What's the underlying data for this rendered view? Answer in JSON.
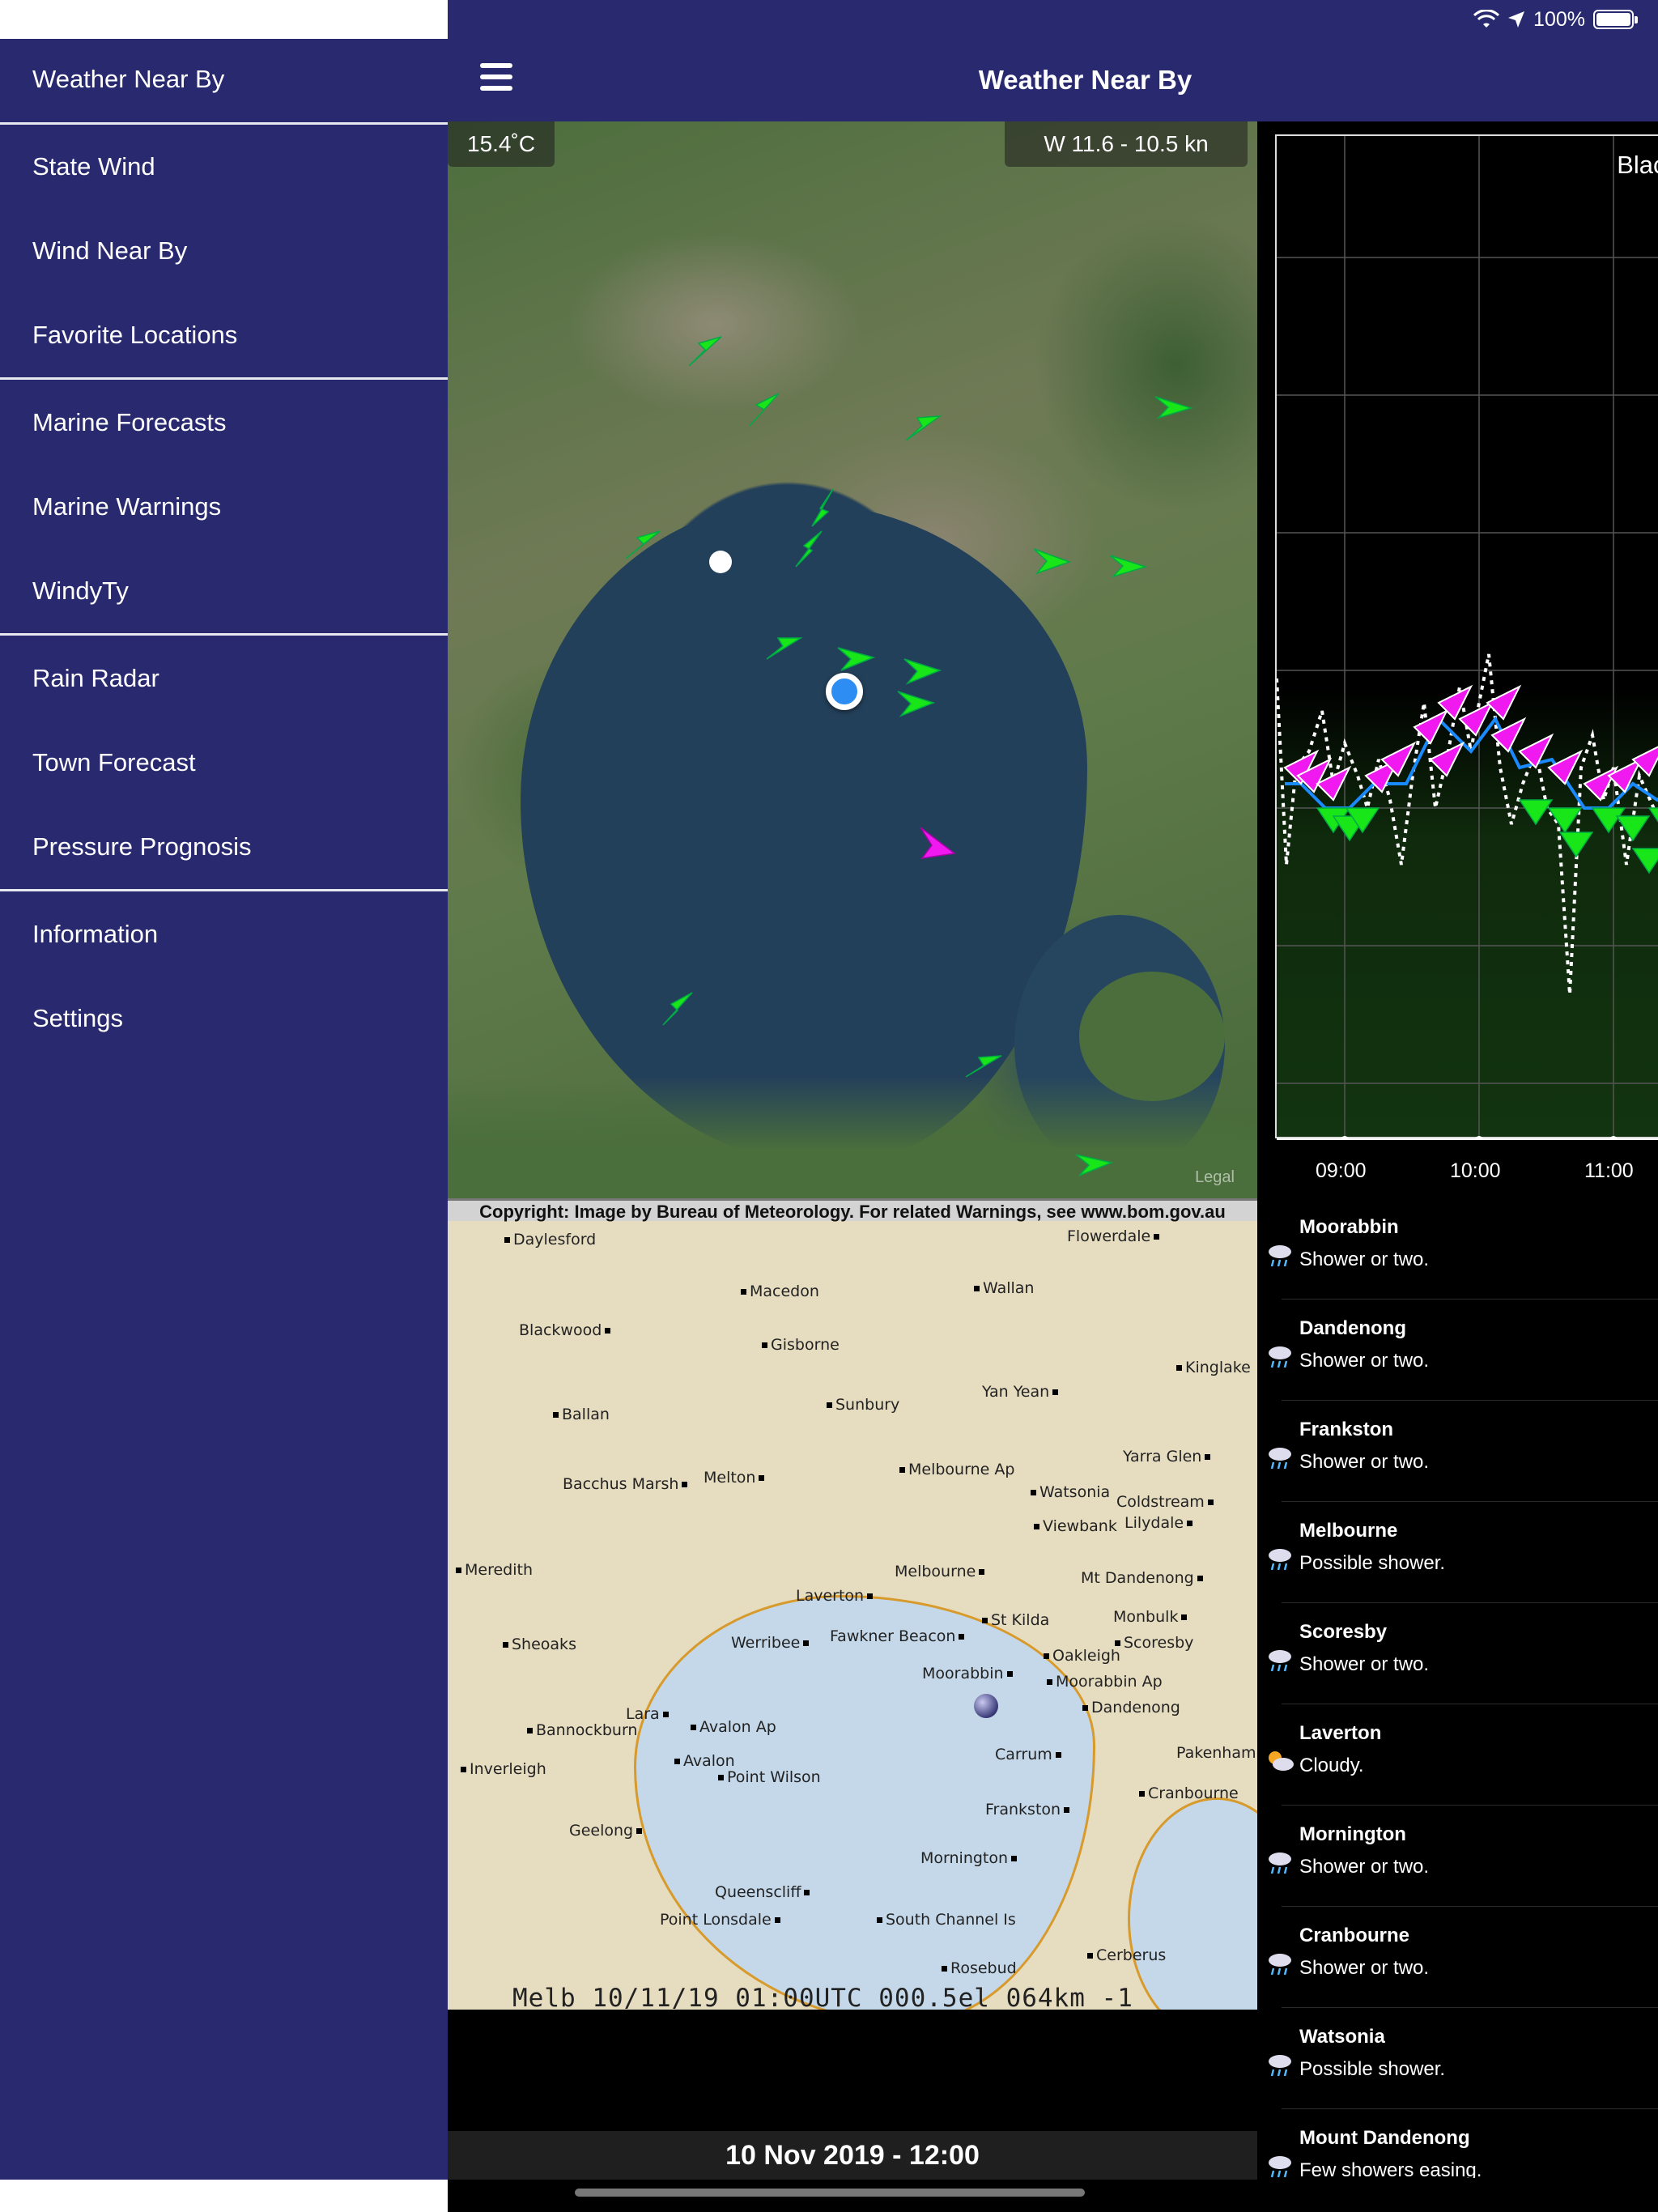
{
  "status_bar": {
    "battery": "100%"
  },
  "sidebar": {
    "items": [
      {
        "label": "Weather Near By"
      },
      {
        "label": "State Wind"
      },
      {
        "label": "Wind Near By"
      },
      {
        "label": "Favorite Locations"
      },
      {
        "label": "Marine Forecasts"
      },
      {
        "label": "Marine Warnings"
      },
      {
        "label": "WindyTy"
      },
      {
        "label": "Rain Radar"
      },
      {
        "label": "Town Forecast"
      },
      {
        "label": "Pressure Prognosis"
      },
      {
        "label": "Information"
      },
      {
        "label": "Settings"
      }
    ]
  },
  "header": {
    "title": "Weather Near By"
  },
  "map": {
    "temperature": "15.4˚C",
    "wind": "W 11.6 - 10.5 kn",
    "legal": "Legal"
  },
  "chart": {
    "title": "Black",
    "x_ticks": [
      "09:00",
      "10:00",
      "11:00"
    ]
  },
  "radar": {
    "copyright": "Copyright: Image by Bureau of Meteorology. For related Warnings, see www.bom.gov.au",
    "footer": "Melb    10/11/19 01:00UTC 000.5el 064km -1",
    "towns": [
      "Daylesford",
      "Flowerdale",
      "Macedon",
      "Wallan",
      "Blackwood",
      "Gisborne",
      "Kinglake",
      "Yan Yean",
      "Sunbury",
      "Ballan",
      "Yarra Glen",
      "Bacchus Marsh",
      "Melton",
      "Melbourne Ap",
      "Watsonia",
      "Coldstream",
      "Viewbank",
      "Lilydale",
      "Meredith",
      "Melbourne",
      "Mt Dandenong",
      "Laverton",
      "St Kilda",
      "Monbulk",
      "Sheoaks",
      "Werribee",
      "Fawkner Beacon",
      "Scoresby",
      "Oakleigh",
      "Moorabbin",
      "Moorabbin Ap",
      "Dandenong",
      "Lara",
      "Avalon Ap",
      "Bannockburn",
      "Avalon",
      "Carrum",
      "Pakenham",
      "Inverleigh",
      "Point Wilson",
      "Cranbourne",
      "Frankston",
      "Geelong",
      "Mornington",
      "Queenscliff",
      "Point Lonsdale",
      "South Channel Is",
      "Cerberus",
      "Rosebud"
    ]
  },
  "timestamp": "10 Nov 2019 - 12:00",
  "forecasts": [
    {
      "name": "Moorabbin",
      "text": "Shower or two.",
      "icon": "shower-icon"
    },
    {
      "name": "Dandenong",
      "text": "Shower or two.",
      "icon": "shower-icon"
    },
    {
      "name": "Frankston",
      "text": "Shower or two.",
      "icon": "shower-icon"
    },
    {
      "name": "Melbourne",
      "text": "Possible shower.",
      "icon": "shower-icon"
    },
    {
      "name": "Scoresby",
      "text": "Shower or two.",
      "icon": "shower-icon"
    },
    {
      "name": "Laverton",
      "text": "Cloudy.",
      "icon": "cloudy-sun-icon"
    },
    {
      "name": "Mornington",
      "text": "Shower or two.",
      "icon": "shower-icon"
    },
    {
      "name": "Cranbourne",
      "text": "Shower or two.",
      "icon": "shower-icon"
    },
    {
      "name": "Watsonia",
      "text": "Possible shower.",
      "icon": "shower-icon"
    },
    {
      "name": "Mount Dandenong",
      "text": "Few showers easing.",
      "icon": "shower-icon"
    }
  ]
}
